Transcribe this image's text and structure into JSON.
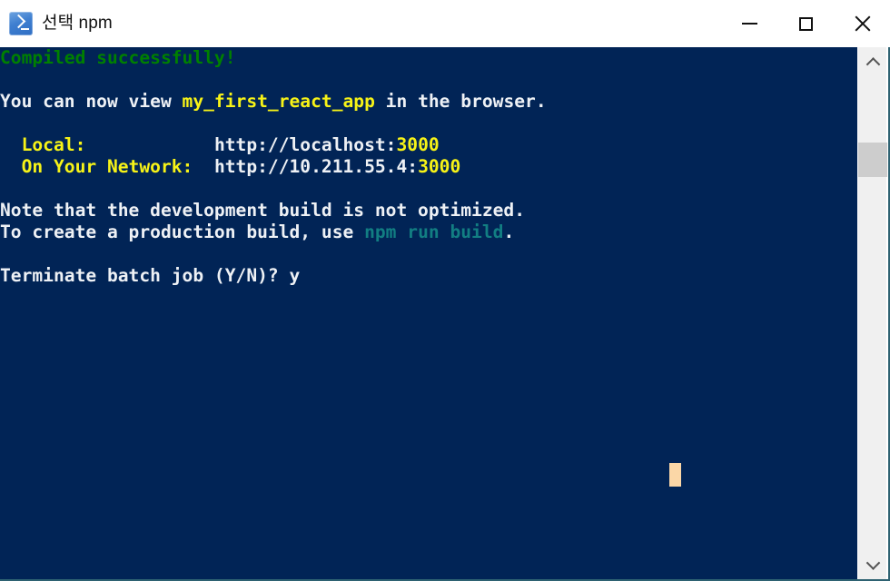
{
  "window": {
    "title": "선택 npm",
    "icon": "command-prompt-icon",
    "controls": {
      "minimize": "—",
      "maximize": "□",
      "close": "✕"
    }
  },
  "colors": {
    "console_background": "#012456",
    "titlebar_background": "#ffffff",
    "title_text": "#111111",
    "success_green": "#008000",
    "default_white": "#eef1f5",
    "highlight_yellow": "#f7f317",
    "command_teal": "#127e82",
    "cursor": "#fbd7a7",
    "window_border": "#2e6272",
    "scrollbar_track": "#f0f0f0",
    "scrollbar_thumb": "#cdcdcd"
  },
  "console": {
    "lines": [
      {
        "id": "line-compiled",
        "segments": [
          {
            "text": "Compiled successfully!",
            "color": "green"
          }
        ]
      },
      {
        "id": "line-blank-1",
        "segments": []
      },
      {
        "id": "line-view-app",
        "segments": [
          {
            "text": "You can now view ",
            "color": "white"
          },
          {
            "text": "my_first_react_app",
            "color": "yellow"
          },
          {
            "text": " in the browser.",
            "color": "white"
          }
        ]
      },
      {
        "id": "line-blank-2",
        "segments": []
      },
      {
        "id": "line-local-url",
        "segments": [
          {
            "text": "  Local:            ",
            "color": "yellow"
          },
          {
            "text": "http://localhost:",
            "color": "white"
          },
          {
            "text": "3000",
            "color": "yellow"
          }
        ]
      },
      {
        "id": "line-network-url",
        "segments": [
          {
            "text": "  On Your Network:  ",
            "color": "yellow"
          },
          {
            "text": "http://10.211.55.4:",
            "color": "white"
          },
          {
            "text": "3000",
            "color": "yellow"
          }
        ]
      },
      {
        "id": "line-blank-3",
        "segments": []
      },
      {
        "id": "line-note-dev-build",
        "segments": [
          {
            "text": "Note that the development build is not optimized.",
            "color": "white"
          }
        ]
      },
      {
        "id": "line-production-build",
        "segments": [
          {
            "text": "To create a production build, use ",
            "color": "white"
          },
          {
            "text": "npm run build",
            "color": "teal"
          },
          {
            "text": ".",
            "color": "white"
          }
        ]
      },
      {
        "id": "line-blank-4",
        "segments": []
      },
      {
        "id": "line-terminate-prompt",
        "segments": [
          {
            "text": "Terminate batch job (Y/N)? y",
            "color": "white"
          }
        ]
      }
    ],
    "cursor": {
      "visible": true,
      "column": 46,
      "row": 19
    }
  },
  "scrollbar": {
    "up_arrow": "scroll-up-arrow",
    "down_arrow": "scroll-down-arrow",
    "thumb_label": "scrollbar-thumb"
  }
}
